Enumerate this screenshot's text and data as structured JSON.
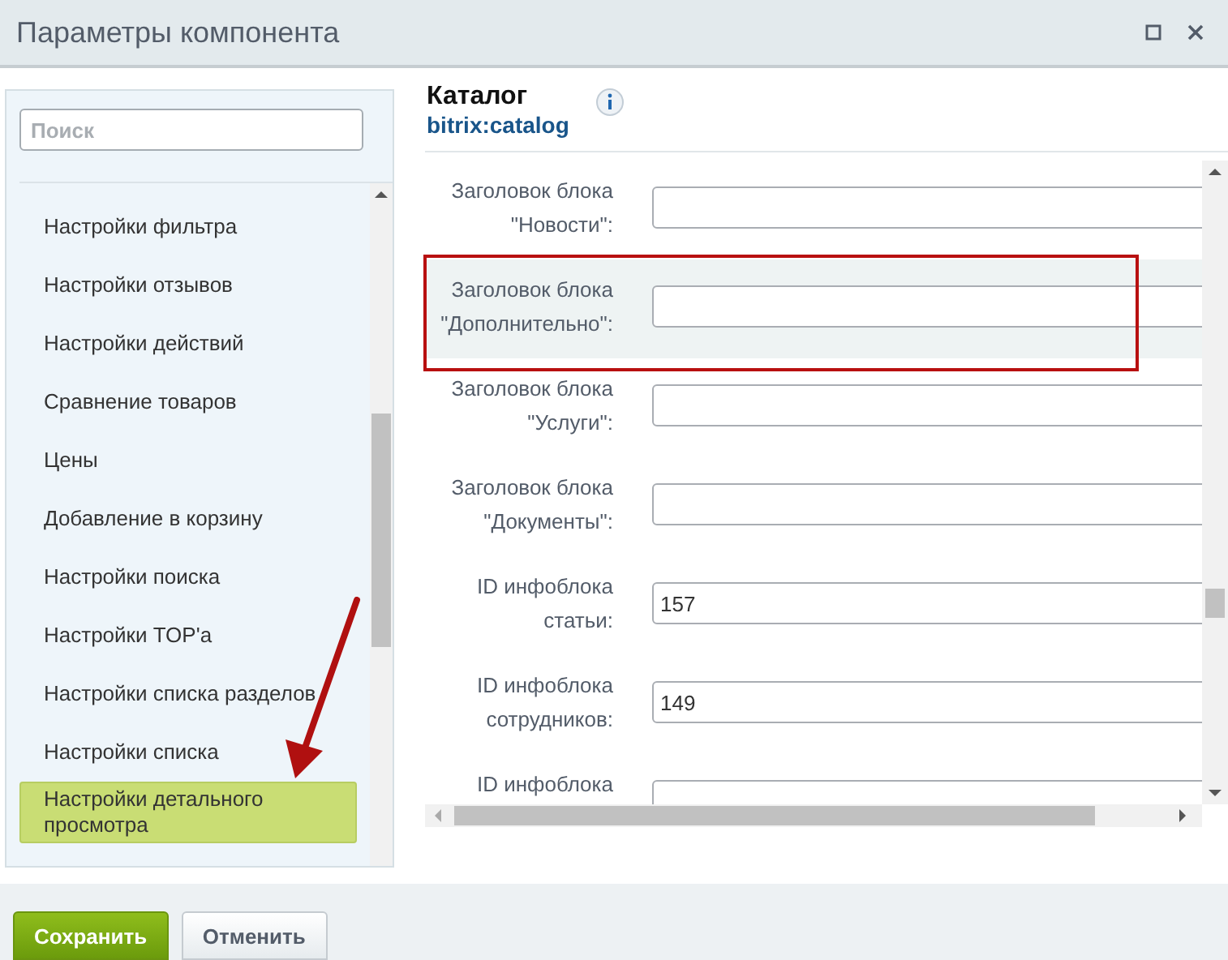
{
  "window": {
    "title": "Параметры компонента"
  },
  "search": {
    "placeholder": "Поиск"
  },
  "sidebar": {
    "items": [
      {
        "label": "Настройки фильтра",
        "selected": false
      },
      {
        "label": "Настройки отзывов",
        "selected": false
      },
      {
        "label": "Настройки действий",
        "selected": false
      },
      {
        "label": "Сравнение товаров",
        "selected": false
      },
      {
        "label": "Цены",
        "selected": false
      },
      {
        "label": "Добавление в корзину",
        "selected": false
      },
      {
        "label": "Настройки поиска",
        "selected": false
      },
      {
        "label": "Настройки TOP'а",
        "selected": false
      },
      {
        "label": "Настройки списка разделов",
        "selected": false
      },
      {
        "label": "Настройки списка",
        "selected": false
      },
      {
        "label": "Настройки детального просмотра",
        "selected": true
      }
    ]
  },
  "component": {
    "title": "Каталог",
    "code": "bitrix:catalog"
  },
  "fields": [
    {
      "label": "Заголовок блока \"Новости\":",
      "highlighted": false
    },
    {
      "label": "Заголовок блока \"Дополнительно\":",
      "highlighted": true
    },
    {
      "label": "Заголовок блока \"Услуги\":",
      "highlighted": false
    },
    {
      "label": "Заголовок блока \"Документы\":",
      "highlighted": false
    },
    {
      "label": "ID инфоблока статьи:",
      "value": "157",
      "highlighted": false
    },
    {
      "label": "ID инфоблока сотрудников:",
      "value": "149",
      "highlighted": false
    },
    {
      "label": "ID инфоблока",
      "highlighted": false
    }
  ],
  "buttons": [
    {
      "label": "Сохранить",
      "kind": "primary"
    },
    {
      "label": "Отменить",
      "kind": "secondary"
    }
  ]
}
